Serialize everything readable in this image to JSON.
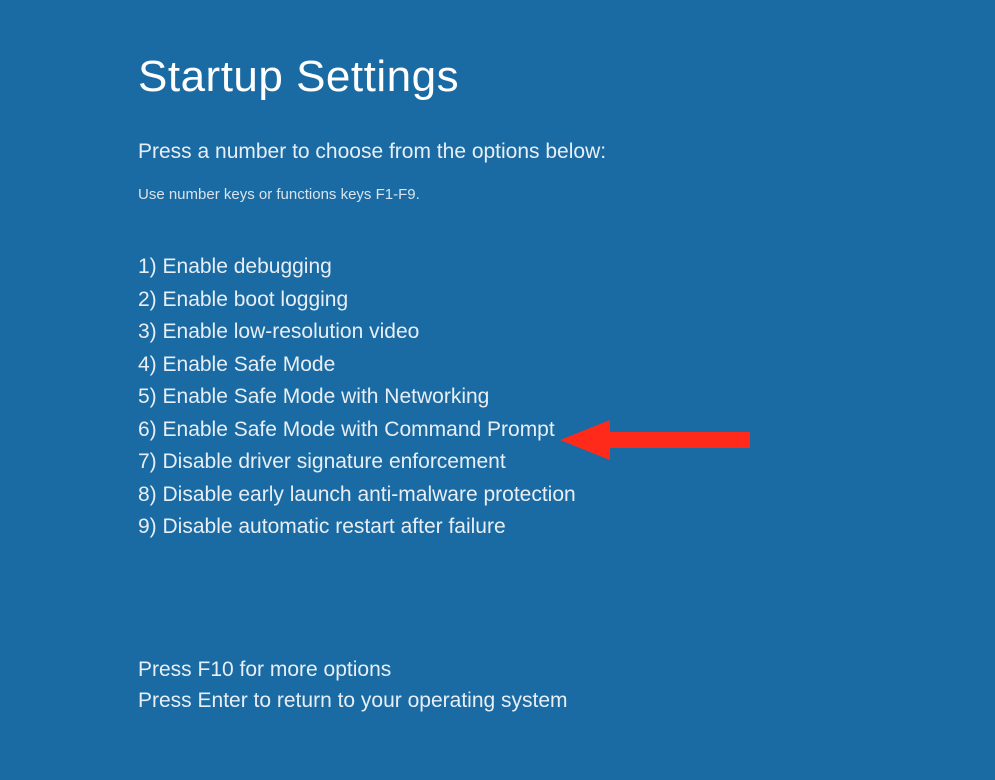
{
  "title": "Startup Settings",
  "instruction": "Press a number to choose from the options below:",
  "hint": "Use number keys or functions keys F1-F9.",
  "options": [
    "1) Enable debugging",
    "2) Enable boot logging",
    "3) Enable low-resolution video",
    "4) Enable Safe Mode",
    "5) Enable Safe Mode with Networking",
    "6) Enable Safe Mode with Command Prompt",
    "7) Disable driver signature enforcement",
    "8) Disable early launch anti-malware protection",
    "9) Disable automatic restart after failure"
  ],
  "footer": {
    "line1": "Press F10 for more options",
    "line2": "Press Enter to return to your operating system"
  },
  "annotation": {
    "arrow_target_index": 6,
    "arrow_color": "#ff2a1a"
  }
}
